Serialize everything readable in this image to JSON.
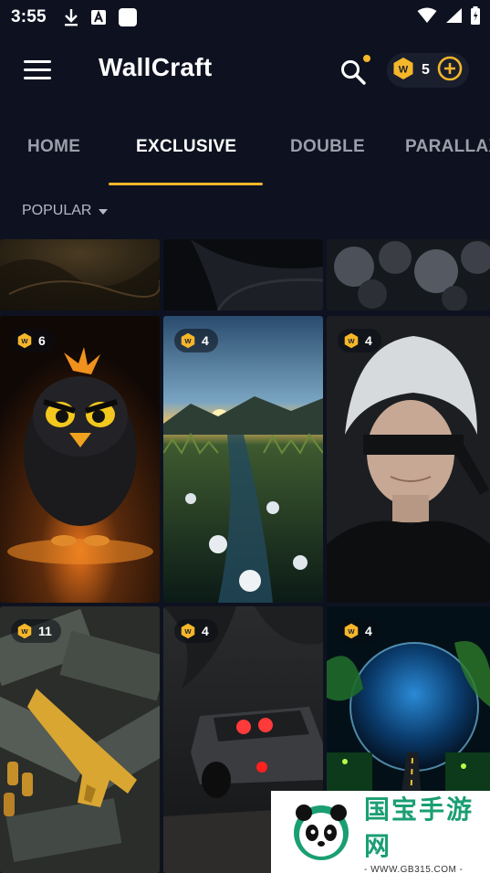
{
  "status_bar": {
    "time": "3:55",
    "icons": [
      "download-icon",
      "a-box-icon",
      "square-icon"
    ],
    "right_icons": [
      "wifi-icon",
      "signal-icon",
      "battery-icon"
    ]
  },
  "app_bar": {
    "title": "WallCraft",
    "coin_balance": "5",
    "icons": [
      "menu-icon",
      "search-icon",
      "coin-icon",
      "add-circle-icon"
    ]
  },
  "tabs": [
    {
      "label": "HOME",
      "active": false
    },
    {
      "label": "EXCLUSIVE",
      "active": true
    },
    {
      "label": "DOUBLE",
      "active": false
    },
    {
      "label": "PARALLAX",
      "active": false
    }
  ],
  "sort": {
    "label": "POPULAR"
  },
  "wallpapers": [
    {
      "id": "top-1",
      "price": ""
    },
    {
      "id": "top-2",
      "price": ""
    },
    {
      "id": "top-3",
      "price": ""
    },
    {
      "id": "angry-bird",
      "price": "6"
    },
    {
      "id": "flower-field",
      "price": "4"
    },
    {
      "id": "blindfold-boy",
      "price": "4"
    },
    {
      "id": "golden-gun",
      "price": "11"
    },
    {
      "id": "dark-car",
      "price": "4"
    },
    {
      "id": "planet-road",
      "price": "4"
    }
  ],
  "watermark": {
    "main": "国宝手游网",
    "sub": "- WWW.GB315.COM -"
  },
  "colors": {
    "background": "#0e1220",
    "accent": "#f5b62a",
    "tab_inactive": "#9aa0ab"
  }
}
